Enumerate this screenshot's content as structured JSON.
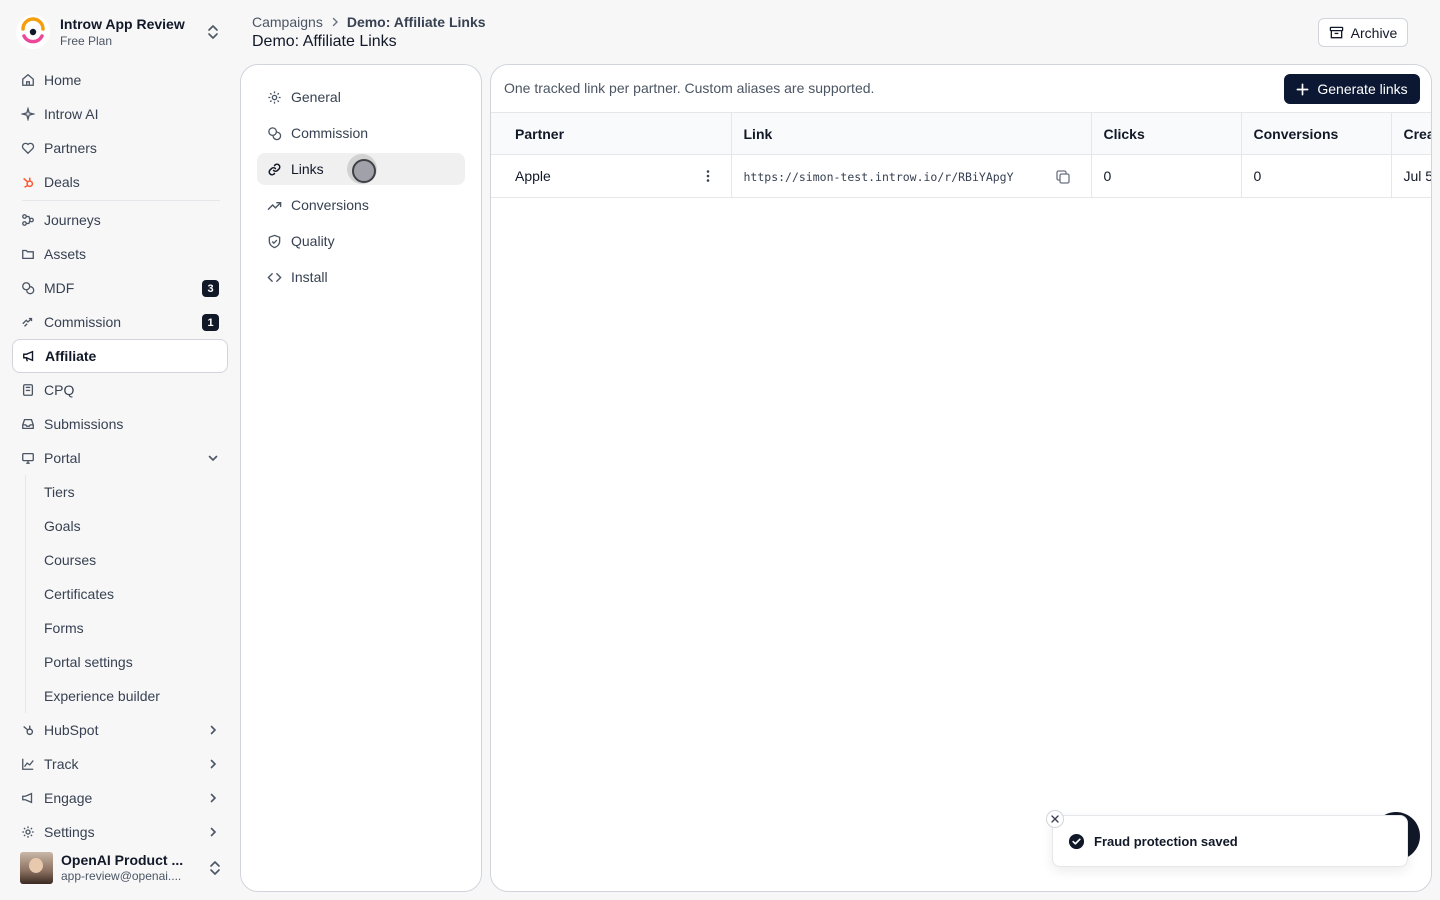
{
  "workspace": {
    "name": "Introw App Review",
    "plan": "Free Plan"
  },
  "nav": {
    "home": "Home",
    "ai": "Introw AI",
    "partners": "Partners",
    "deals": "Deals",
    "journeys": "Journeys",
    "assets": "Assets",
    "mdf": "MDF",
    "mdf_badge": "3",
    "commission": "Commission",
    "commission_badge": "1",
    "affiliate": "Affiliate",
    "cpq": "CPQ",
    "submissions": "Submissions",
    "portal": "Portal",
    "portal_children": [
      "Tiers",
      "Goals",
      "Courses",
      "Certificates",
      "Forms",
      "Portal settings",
      "Experience builder"
    ],
    "hubspot": "HubSpot",
    "track": "Track",
    "engage": "Engage",
    "settings": "Settings"
  },
  "user": {
    "name": "OpenAI Product ...",
    "email": "app-review@openai...."
  },
  "breadcrumb": {
    "root": "Campaigns",
    "current": "Demo: Affiliate Links"
  },
  "page": {
    "title": "Demo: Affiliate Links",
    "archive_label": "Archive"
  },
  "panel": {
    "items": [
      "General",
      "Commission",
      "Links",
      "Conversions",
      "Quality",
      "Install"
    ],
    "active": "Links"
  },
  "main": {
    "description": "One tracked link per partner. Custom aliases are supported.",
    "generate_label": "Generate links",
    "columns": [
      "Partner",
      "Link",
      "Clicks",
      "Conversions",
      "Crea"
    ],
    "rows": [
      {
        "partner": "Apple",
        "link": "https://simon-test.introw.io/r/RBiYApgY",
        "clicks": "0",
        "conversions": "0",
        "created": "Jul 5"
      }
    ]
  },
  "toast": {
    "message": "Fraud protection saved"
  },
  "colors": {
    "primary": "#0c1833",
    "hubspot": "#ff5c35"
  }
}
